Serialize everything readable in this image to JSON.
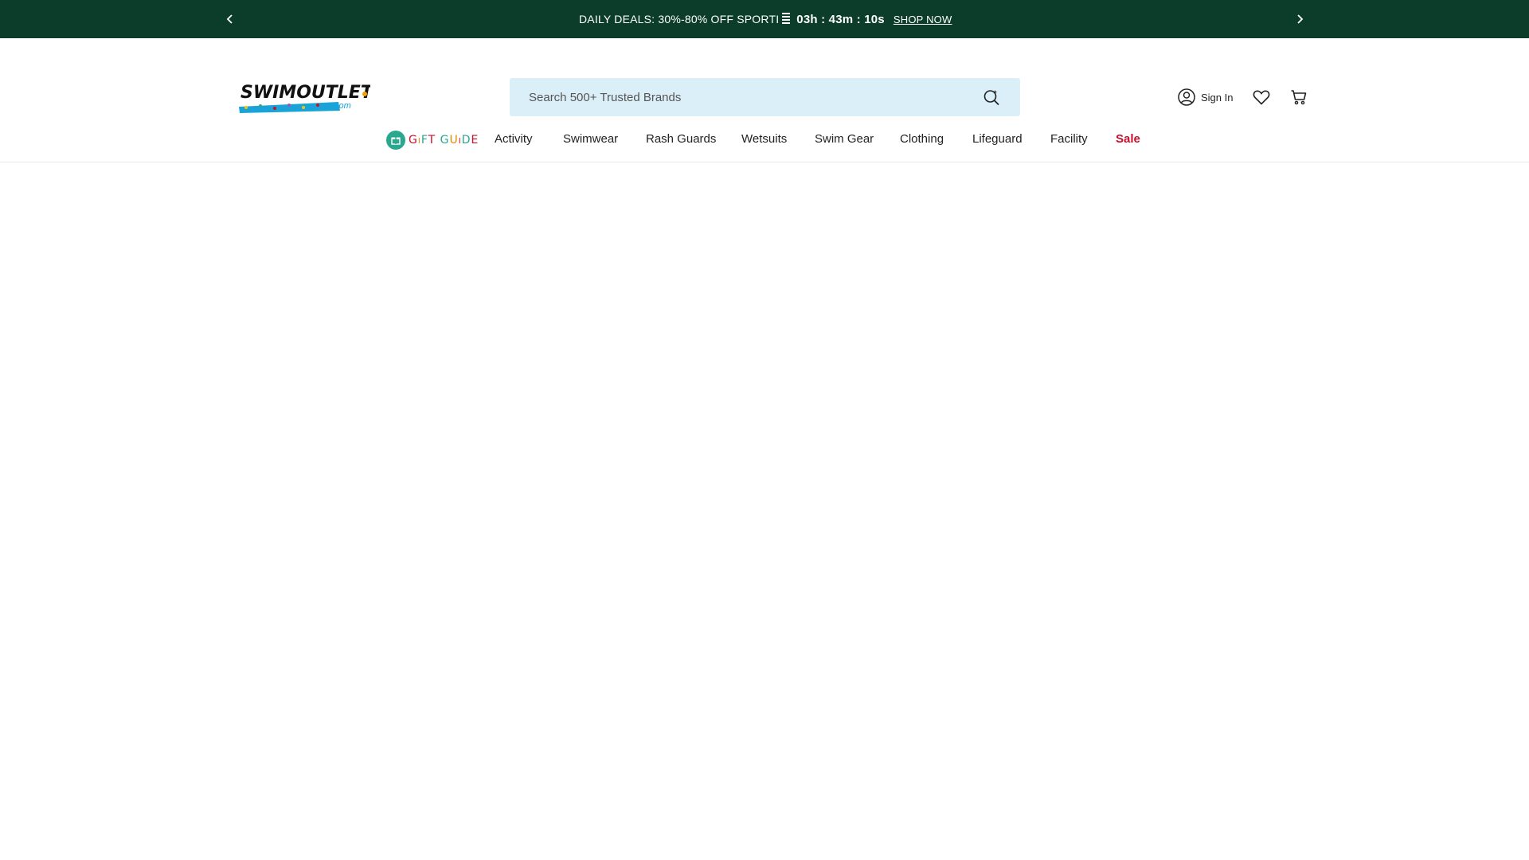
{
  "promo": {
    "text": "DAILY DEALS: 30%-80% OFF SPORTI",
    "countdown": "03h : 43m : 10s",
    "cta": "SHOP NOW",
    "bg_color": "#0b3d2a"
  },
  "header": {
    "logo_alt": "SwimOutlet.com",
    "search": {
      "placeholder": "Search 500+ Trusted Brands",
      "value": ""
    },
    "account_label": "Sign In"
  },
  "nav": {
    "gift_guide": [
      "G",
      "i",
      "F",
      "T",
      " ",
      "G",
      "U",
      "i",
      "D",
      "E"
    ],
    "gift_colors": [
      "#c8102e",
      "#e08a00",
      "#2aa88f",
      "#c8102e",
      "#222",
      "#2aa88f",
      "#e08a00",
      "#c8102e",
      "#2aa88f",
      "#c8102e"
    ],
    "items": [
      {
        "label": "Activity"
      },
      {
        "label": "Swimwear"
      },
      {
        "label": "Rash Guards"
      },
      {
        "label": "Wetsuits"
      },
      {
        "label": "Swim Gear"
      },
      {
        "label": "Clothing"
      },
      {
        "label": "Lifeguard"
      },
      {
        "label": "Facility"
      },
      {
        "label": "Sale"
      }
    ],
    "sale_color": "#c8102e"
  }
}
